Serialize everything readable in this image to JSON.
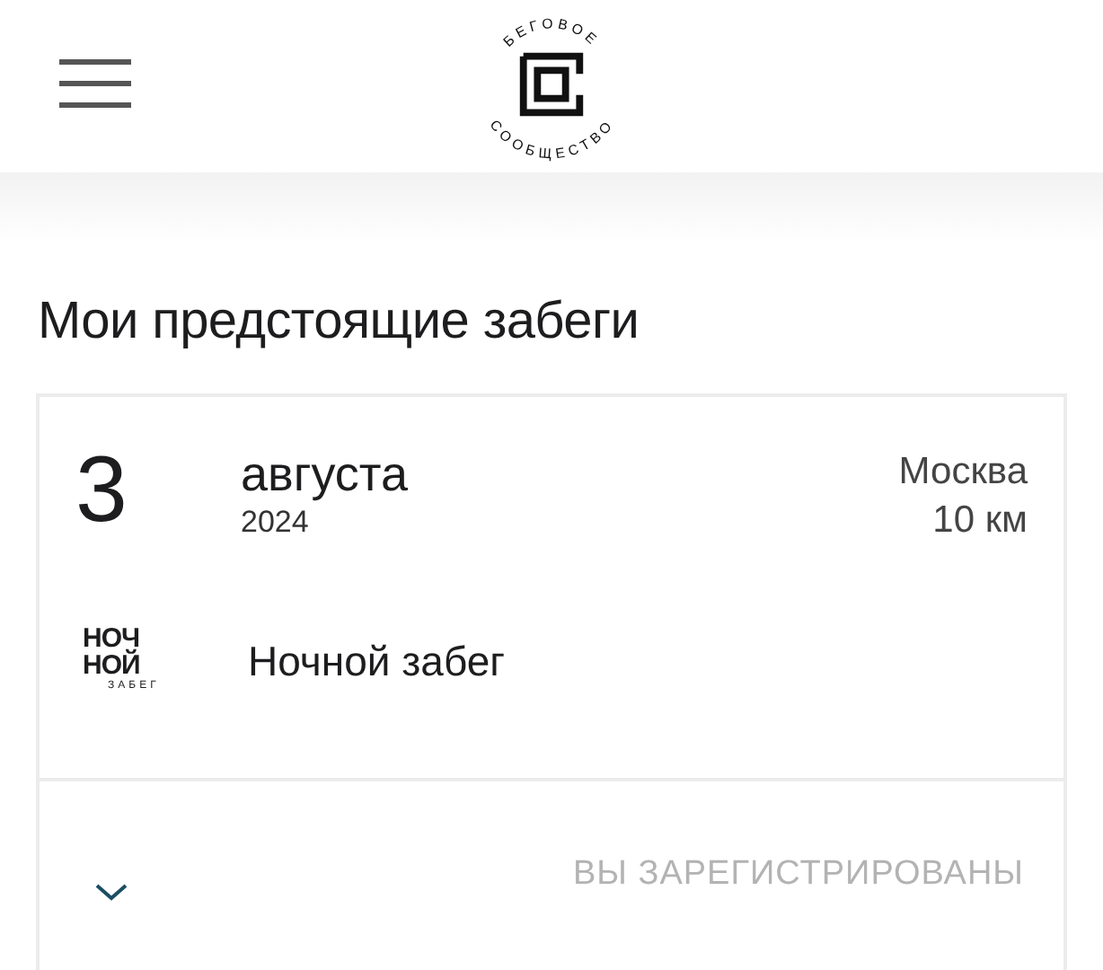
{
  "header": {
    "logo_top": "БЕГОВОЕ",
    "logo_bottom": "СООБЩЕСТВО"
  },
  "title": "Мои предстоящие забеги",
  "events": [
    {
      "day": "3",
      "month": "августа",
      "year": "2024",
      "city": "Москва",
      "distance": "10 км",
      "logo_lines": [
        "НОЧ",
        "НОЙ"
      ],
      "logo_caption": "ЗАБЕГ",
      "name": "Ночной забег",
      "expanded": false,
      "status": "ВЫ ЗАРЕГИСТРИРОВАНЫ"
    }
  ]
}
